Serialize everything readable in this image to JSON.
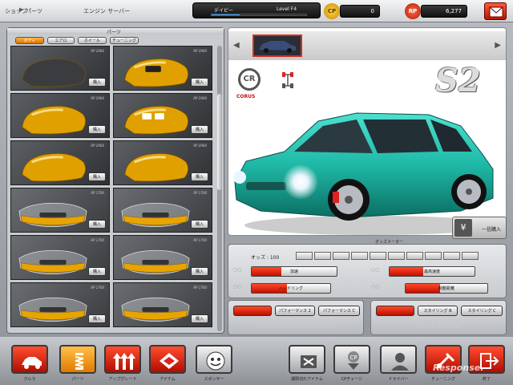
{
  "header": {
    "breadcrumb": [
      "ショップ",
      "パーツ",
      "エンジン サーバー"
    ],
    "breadcrumb_sep": "▶",
    "player_name": "デイビー",
    "level": "Level F4",
    "level_progress": 0.3,
    "cp_label": "CP",
    "cp_value": "0",
    "rp_label": "RP",
    "rp_value": "6,277"
  },
  "parts": {
    "title": "パーツ",
    "tabs": [
      "ボディ",
      "エアロ",
      "ホイール",
      "チューニング"
    ],
    "active_tab": 0,
    "buy_label": "購入",
    "items": [
      {
        "price": "RP 2900"
      },
      {
        "price": "RP 2900"
      },
      {
        "price": "RP 2900"
      },
      {
        "price": "RP 2900"
      },
      {
        "price": "RP 2900"
      },
      {
        "price": "RP 2900"
      },
      {
        "price": "RP 1700"
      },
      {
        "price": "RP 1700"
      },
      {
        "price": "RP 1700"
      },
      {
        "price": "RP 1700"
      },
      {
        "price": "RP 1700"
      },
      {
        "price": "RP 1700"
      }
    ]
  },
  "car": {
    "brand_logo": "CR",
    "brand": "CORUS",
    "model": "S2",
    "body_color": "#1fb8a6",
    "bulk_buy_icon": "¥",
    "bulk_buy_label": "一括購入"
  },
  "odds": {
    "title": "オッズメーター",
    "label": "オッズ : 100",
    "segments": 10
  },
  "stats": [
    {
      "label": "加速",
      "value": 0.35
    },
    {
      "label": "最高速度",
      "value": 0.4
    },
    {
      "label": "ハンドリング",
      "value": 0.45
    },
    {
      "label": "制動距離",
      "value": 0.42
    }
  ],
  "tuning": {
    "left": {
      "buttons": [
        "",
        "パフォーマンス 2",
        "パフォーマンス C"
      ],
      "caption": "PERFORMANCE"
    },
    "right": {
      "buttons": [
        "",
        "スタイリング B",
        "スタイリング C"
      ],
      "caption": "STYLING"
    }
  },
  "nav": [
    {
      "label": "クルマ",
      "icon": "car-icon",
      "style": "red"
    },
    {
      "label": "パーツ",
      "icon": "spring-icon",
      "style": "orange"
    },
    {
      "label": "アップグレード",
      "icon": "upgrade-arrows-icon",
      "style": "red"
    },
    {
      "label": "アイテム",
      "icon": "item-icon",
      "style": "red"
    },
    {
      "label": "スポンサー",
      "icon": "sponsor-icon",
      "style": "gray"
    },
    {
      "label": "期限切れアイテム",
      "icon": "expired-item-icon",
      "style": "gray"
    },
    {
      "label": "CPチャージ",
      "icon": "cp-charge-icon",
      "style": "gray"
    },
    {
      "label": "ドライバー",
      "icon": "driver-icon",
      "style": "gray"
    },
    {
      "label": "チューニング",
      "icon": "tuning-icon",
      "style": "red"
    },
    {
      "label": "終了",
      "icon": "exit-icon",
      "style": "red"
    }
  ],
  "watermark": "Response."
}
